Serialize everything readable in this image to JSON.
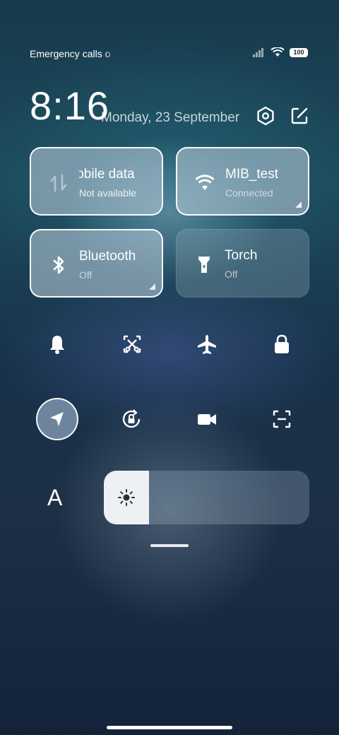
{
  "status_bar": {
    "carrier_text": "Emergency calls o",
    "battery": "100"
  },
  "header": {
    "time": "8:16",
    "date": "Monday, 23 September"
  },
  "tiles": {
    "mobile_data": {
      "label": "lobile data",
      "sub": "Not available",
      "state": "off"
    },
    "wifi": {
      "label": "MIB_test",
      "sub": "Connected",
      "state": "on"
    },
    "bluetooth": {
      "label": "Bluetooth",
      "sub": "Off",
      "state": "on-outline"
    },
    "torch": {
      "label": "Torch",
      "sub": "Off",
      "state": "off"
    }
  },
  "toggles_row1": [
    "bell-icon",
    "screenshot-icon",
    "airplane-icon",
    "lock-icon"
  ],
  "toggles_row2": [
    "location-icon",
    "rotation-lock-icon",
    "video-icon",
    "scan-icon"
  ],
  "brightness": {
    "auto_label": "A",
    "level": 0.22
  },
  "colors": {
    "active_tile": "#afc3d2",
    "slider_fill": "#eef1f3"
  }
}
